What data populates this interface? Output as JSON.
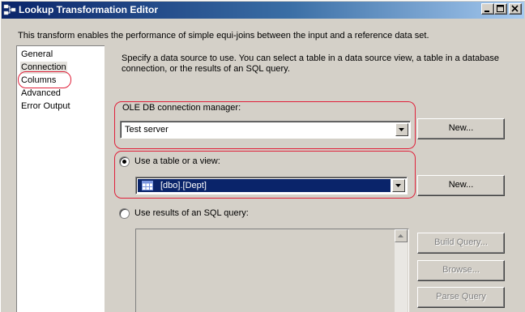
{
  "window": {
    "title": "Lookup Transformation Editor",
    "icon": "lookup-transform-icon"
  },
  "description": "This transform enables the performance of simple equi-joins between the input and a reference data set.",
  "nav": {
    "items": [
      {
        "label": "General"
      },
      {
        "label": "Connection",
        "selected": true
      },
      {
        "label": "Columns",
        "highlighted": true
      },
      {
        "label": "Advanced"
      },
      {
        "label": "Error Output"
      }
    ]
  },
  "connection": {
    "hint": "Specify a data source to use. You can select a table in a data source view, a table in a database connection, or the results of an SQL query.",
    "manager_label": "OLE DB connection manager:",
    "manager_value": "Test server",
    "new_button": "New...",
    "use_table_label": "Use a table or a view:",
    "use_table_checked": true,
    "table_value": "[dbo].[Dept]",
    "new_table_button": "New...",
    "use_sql_label": "Use results of an SQL query:",
    "use_sql_checked": false,
    "sql_text": "",
    "build_query_button": "Build Query...",
    "browse_button": "Browse...",
    "parse_query_button": "Parse Query"
  },
  "colors": {
    "titlebar_start": "#0a246a",
    "titlebar_end": "#a6caf0",
    "window_bg": "#d4d0c8",
    "selection": "#0a246a",
    "annotation_red": "#e0203a"
  }
}
